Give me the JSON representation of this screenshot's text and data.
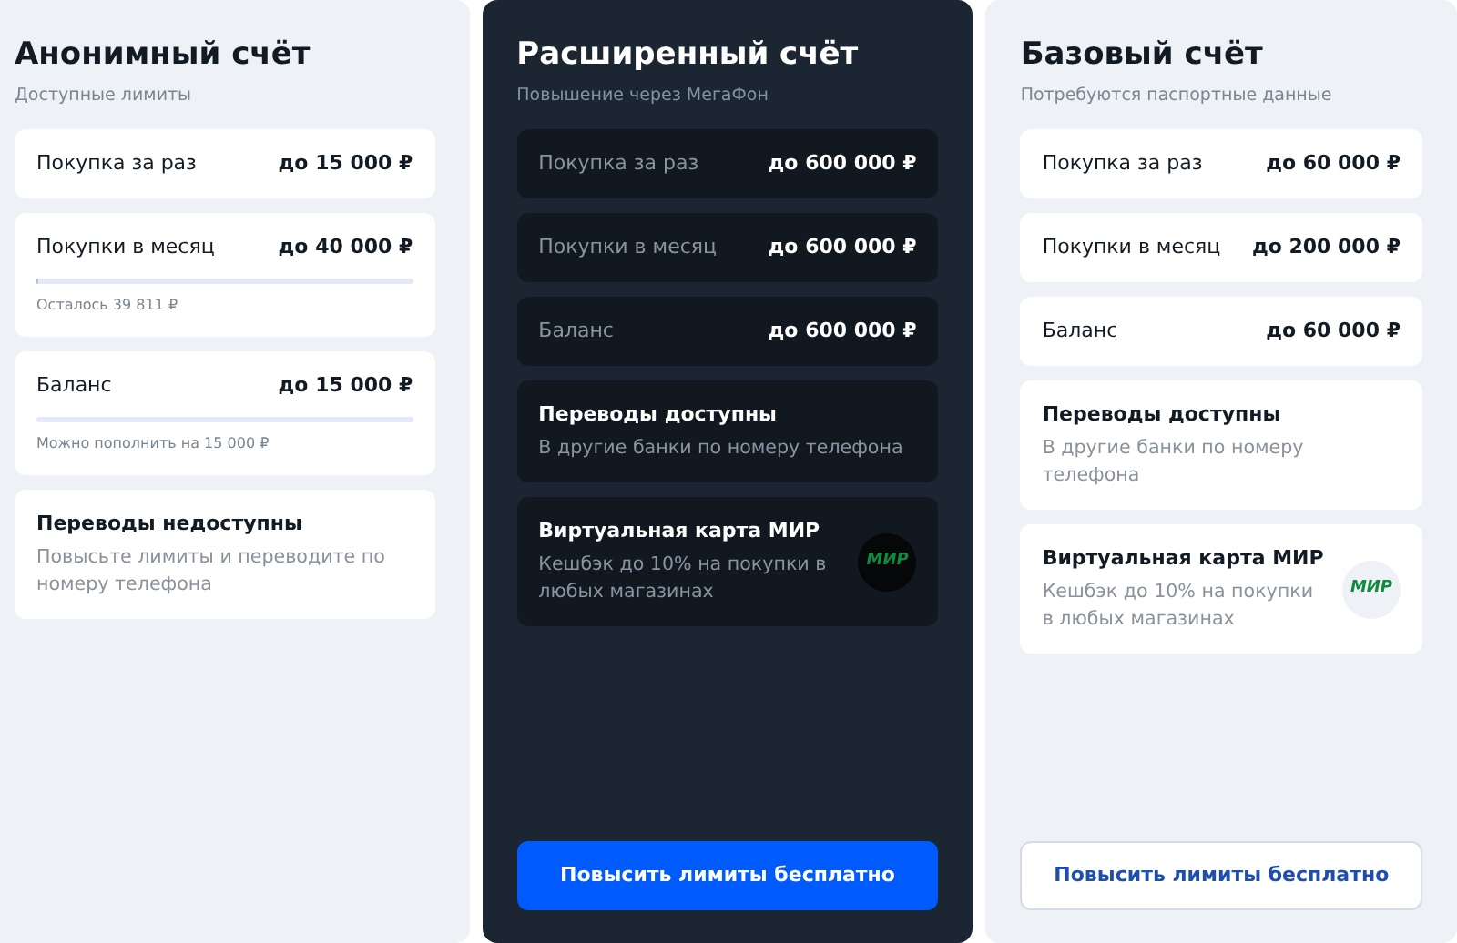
{
  "plans": [
    {
      "kind": "light",
      "title": "Анонимный счёт",
      "subtitle": "Доступные лимиты",
      "items": [
        {
          "kind": "limit",
          "label": "Покупка за раз",
          "value": "до 15 000 ₽"
        },
        {
          "kind": "limit",
          "label": "Покупки в месяц",
          "value": "до 40 000 ₽",
          "level": 0.005,
          "note": "Осталось 39 811 ₽"
        },
        {
          "kind": "limit",
          "label": "Баланс",
          "value": "до 15 000 ₽",
          "level": 0,
          "note": "Можно пополнить на 15 000 ₽"
        },
        {
          "kind": "feature",
          "title": "Переводы недоступны",
          "text": "Повысьте лимиты и переводите по номеру телефона"
        }
      ]
    },
    {
      "kind": "dark",
      "title": "Расширенный счёт",
      "subtitle": "Повышение через МегаФон",
      "items": [
        {
          "kind": "limit",
          "label": "Покупка за раз",
          "value": "до 600 000 ₽"
        },
        {
          "kind": "limit",
          "label": "Покупки в месяц",
          "value": "до 600 000 ₽"
        },
        {
          "kind": "limit",
          "label": "Баланс",
          "value": "до 600 000 ₽"
        },
        {
          "kind": "feature",
          "title": "Переводы доступны",
          "text": "В другие банки по номеру телефона"
        },
        {
          "kind": "card",
          "title": "Виртуальная карта МИР",
          "text": "Кешбэк до 10% на покупки в любых магазинах",
          "logo": "МИР"
        }
      ],
      "button": {
        "label": "Повысить лимиты бесплатно",
        "kind": "primary"
      }
    },
    {
      "kind": "light",
      "title": "Базовый счёт",
      "subtitle": "Потребуются паспортные данные",
      "items": [
        {
          "kind": "limit",
          "label": "Покупка за раз",
          "value": "до 60 000 ₽"
        },
        {
          "kind": "limit",
          "label": "Покупки в месяц",
          "value": "до 200 000 ₽"
        },
        {
          "kind": "limit",
          "label": "Баланс",
          "value": "до 60 000 ₽"
        },
        {
          "kind": "feature",
          "title": "Переводы доступны",
          "text": "В другие банки по номеру телефона"
        },
        {
          "kind": "card",
          "title": "Виртуальная карта МИР",
          "text": "Кешбэк до 10% на покупки в любых магазинах",
          "logo": "МИР"
        }
      ],
      "button": {
        "label": "Повысить лимиты бесплатно",
        "kind": "outline"
      }
    }
  ]
}
